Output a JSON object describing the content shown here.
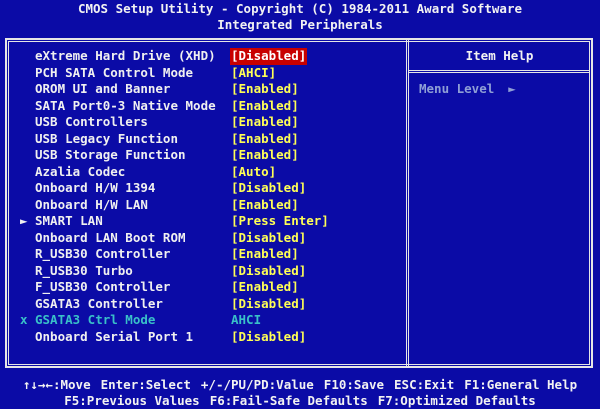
{
  "header": {
    "title": "CMOS Setup Utility - Copyright (C) 1984-2011 Award Software",
    "subtitle": "Integrated Peripherals"
  },
  "help": {
    "title": "Item Help",
    "menu_level_label": "Menu Level",
    "menu_level_arrow": "►"
  },
  "items": [
    {
      "label": "eXtreme Hard Drive (XHD)",
      "value": "[Disabled]",
      "marker": "",
      "selected": true
    },
    {
      "label": "PCH SATA Control Mode",
      "value": "[AHCI]",
      "marker": ""
    },
    {
      "label": "OROM UI and Banner",
      "value": "[Enabled]",
      "marker": ""
    },
    {
      "label": "SATA Port0-3 Native Mode",
      "value": "[Enabled]",
      "marker": ""
    },
    {
      "label": "USB Controllers",
      "value": "[Enabled]",
      "marker": ""
    },
    {
      "label": "USB Legacy Function",
      "value": "[Enabled]",
      "marker": ""
    },
    {
      "label": "USB Storage Function",
      "value": "[Enabled]",
      "marker": ""
    },
    {
      "label": "Azalia Codec",
      "value": "[Auto]",
      "marker": ""
    },
    {
      "label": "Onboard H/W 1394",
      "value": "[Disabled]",
      "marker": ""
    },
    {
      "label": "Onboard H/W LAN",
      "value": "[Enabled]",
      "marker": ""
    },
    {
      "label": "SMART LAN",
      "value": "[Press Enter]",
      "marker": "►"
    },
    {
      "label": "Onboard LAN Boot ROM",
      "value": "[Disabled]",
      "marker": ""
    },
    {
      "label": "R_USB30 Controller",
      "value": "[Enabled]",
      "marker": ""
    },
    {
      "label": "R_USB30 Turbo",
      "value": "[Disabled]",
      "marker": ""
    },
    {
      "label": "F_USB30 Controller",
      "value": "[Enabled]",
      "marker": ""
    },
    {
      "label": "GSATA3 Controller",
      "value": "[Disabled]",
      "marker": ""
    },
    {
      "label": "GSATA3 Ctrl Mode",
      "value": "AHCI",
      "marker": "x",
      "disabled": true
    },
    {
      "label": "Onboard Serial Port 1",
      "value": "[Disabled]",
      "marker": ""
    }
  ],
  "footer": {
    "line1": [
      "↑↓→←:Move",
      "Enter:Select",
      "+/-/PU/PD:Value",
      "F10:Save",
      "ESC:Exit",
      "F1:General Help"
    ],
    "line2": [
      "F5:Previous Values",
      "F6:Fail-Safe Defaults",
      "F7:Optimized Defaults"
    ]
  }
}
